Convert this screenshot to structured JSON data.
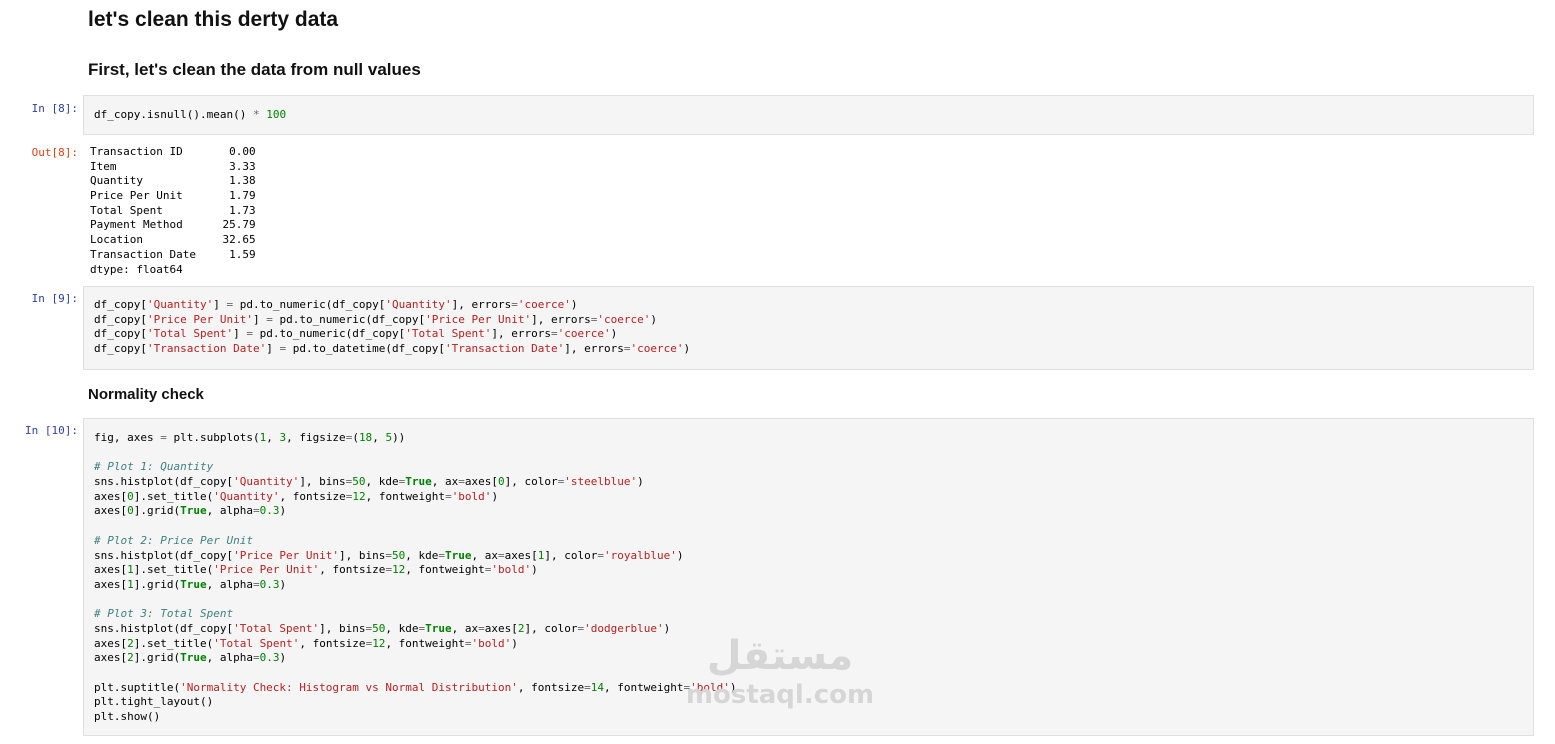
{
  "markdown": {
    "title": "let's clean this derty data",
    "subtitle_nulls": "First, let's clean the data from null values",
    "subtitle_normality": "Normality check"
  },
  "prompts": {
    "in8": "In [8]:",
    "out8": "Out[8]:",
    "in9": "In [9]:",
    "in10": "In [10]:"
  },
  "cells": {
    "in8": {
      "lines": [
        [
          {
            "t": "df_copy.isnull().mean() "
          },
          {
            "t": "*",
            "c": "o"
          },
          {
            "t": " "
          },
          {
            "t": "100",
            "c": "n"
          }
        ]
      ]
    },
    "in9": {
      "lines": [
        [
          {
            "t": "df_copy["
          },
          {
            "t": "'Quantity'",
            "c": "s"
          },
          {
            "t": "] "
          },
          {
            "t": "=",
            "c": "o"
          },
          {
            "t": " pd.to_numeric(df_copy["
          },
          {
            "t": "'Quantity'",
            "c": "s"
          },
          {
            "t": "], errors"
          },
          {
            "t": "=",
            "c": "o"
          },
          {
            "t": "'coerce'",
            "c": "s"
          },
          {
            "t": ")"
          }
        ],
        [
          {
            "t": "df_copy["
          },
          {
            "t": "'Price Per Unit'",
            "c": "s"
          },
          {
            "t": "] "
          },
          {
            "t": "=",
            "c": "o"
          },
          {
            "t": " pd.to_numeric(df_copy["
          },
          {
            "t": "'Price Per Unit'",
            "c": "s"
          },
          {
            "t": "], errors"
          },
          {
            "t": "=",
            "c": "o"
          },
          {
            "t": "'coerce'",
            "c": "s"
          },
          {
            "t": ")"
          }
        ],
        [
          {
            "t": "df_copy["
          },
          {
            "t": "'Total Spent'",
            "c": "s"
          },
          {
            "t": "] "
          },
          {
            "t": "=",
            "c": "o"
          },
          {
            "t": " pd.to_numeric(df_copy["
          },
          {
            "t": "'Total Spent'",
            "c": "s"
          },
          {
            "t": "], errors"
          },
          {
            "t": "=",
            "c": "o"
          },
          {
            "t": "'coerce'",
            "c": "s"
          },
          {
            "t": ")"
          }
        ],
        [
          {
            "t": "df_copy["
          },
          {
            "t": "'Transaction Date'",
            "c": "s"
          },
          {
            "t": "] "
          },
          {
            "t": "=",
            "c": "o"
          },
          {
            "t": " pd.to_datetime(df_copy["
          },
          {
            "t": "'Transaction Date'",
            "c": "s"
          },
          {
            "t": "], errors"
          },
          {
            "t": "=",
            "c": "o"
          },
          {
            "t": "'coerce'",
            "c": "s"
          },
          {
            "t": ")"
          }
        ]
      ]
    },
    "in10": {
      "lines": [
        [
          {
            "t": "fig, axes "
          },
          {
            "t": "=",
            "c": "o"
          },
          {
            "t": " plt.subplots("
          },
          {
            "t": "1",
            "c": "n"
          },
          {
            "t": ", "
          },
          {
            "t": "3",
            "c": "n"
          },
          {
            "t": ", figsize"
          },
          {
            "t": "=",
            "c": "o"
          },
          {
            "t": "("
          },
          {
            "t": "18",
            "c": "n"
          },
          {
            "t": ", "
          },
          {
            "t": "5",
            "c": "n"
          },
          {
            "t": "))"
          }
        ],
        [],
        [
          {
            "t": "# Plot 1: Quantity",
            "c": "c"
          }
        ],
        [
          {
            "t": "sns.histplot(df_copy["
          },
          {
            "t": "'Quantity'",
            "c": "s"
          },
          {
            "t": "], bins"
          },
          {
            "t": "=",
            "c": "o"
          },
          {
            "t": "50",
            "c": "n"
          },
          {
            "t": ", kde"
          },
          {
            "t": "=",
            "c": "o"
          },
          {
            "t": "True",
            "c": "k"
          },
          {
            "t": ", ax"
          },
          {
            "t": "=",
            "c": "o"
          },
          {
            "t": "axes["
          },
          {
            "t": "0",
            "c": "n"
          },
          {
            "t": "], color"
          },
          {
            "t": "=",
            "c": "o"
          },
          {
            "t": "'steelblue'",
            "c": "s"
          },
          {
            "t": ")"
          }
        ],
        [
          {
            "t": "axes["
          },
          {
            "t": "0",
            "c": "n"
          },
          {
            "t": "].set_title("
          },
          {
            "t": "'Quantity'",
            "c": "s"
          },
          {
            "t": ", fontsize"
          },
          {
            "t": "=",
            "c": "o"
          },
          {
            "t": "12",
            "c": "n"
          },
          {
            "t": ", fontweight"
          },
          {
            "t": "=",
            "c": "o"
          },
          {
            "t": "'bold'",
            "c": "s"
          },
          {
            "t": ")"
          }
        ],
        [
          {
            "t": "axes["
          },
          {
            "t": "0",
            "c": "n"
          },
          {
            "t": "].grid("
          },
          {
            "t": "True",
            "c": "k"
          },
          {
            "t": ", alpha"
          },
          {
            "t": "=",
            "c": "o"
          },
          {
            "t": "0.3",
            "c": "n"
          },
          {
            "t": ")"
          }
        ],
        [],
        [
          {
            "t": "# Plot 2: Price Per Unit",
            "c": "c"
          }
        ],
        [
          {
            "t": "sns.histplot(df_copy["
          },
          {
            "t": "'Price Per Unit'",
            "c": "s"
          },
          {
            "t": "], bins"
          },
          {
            "t": "=",
            "c": "o"
          },
          {
            "t": "50",
            "c": "n"
          },
          {
            "t": ", kde"
          },
          {
            "t": "=",
            "c": "o"
          },
          {
            "t": "True",
            "c": "k"
          },
          {
            "t": ", ax"
          },
          {
            "t": "=",
            "c": "o"
          },
          {
            "t": "axes["
          },
          {
            "t": "1",
            "c": "n"
          },
          {
            "t": "], color"
          },
          {
            "t": "=",
            "c": "o"
          },
          {
            "t": "'royalblue'",
            "c": "s"
          },
          {
            "t": ")"
          }
        ],
        [
          {
            "t": "axes["
          },
          {
            "t": "1",
            "c": "n"
          },
          {
            "t": "].set_title("
          },
          {
            "t": "'Price Per Unit'",
            "c": "s"
          },
          {
            "t": ", fontsize"
          },
          {
            "t": "=",
            "c": "o"
          },
          {
            "t": "12",
            "c": "n"
          },
          {
            "t": ", fontweight"
          },
          {
            "t": "=",
            "c": "o"
          },
          {
            "t": "'bold'",
            "c": "s"
          },
          {
            "t": ")"
          }
        ],
        [
          {
            "t": "axes["
          },
          {
            "t": "1",
            "c": "n"
          },
          {
            "t": "].grid("
          },
          {
            "t": "True",
            "c": "k"
          },
          {
            "t": ", alpha"
          },
          {
            "t": "=",
            "c": "o"
          },
          {
            "t": "0.3",
            "c": "n"
          },
          {
            "t": ")"
          }
        ],
        [],
        [
          {
            "t": "# Plot 3: Total Spent",
            "c": "c"
          }
        ],
        [
          {
            "t": "sns.histplot(df_copy["
          },
          {
            "t": "'Total Spent'",
            "c": "s"
          },
          {
            "t": "], bins"
          },
          {
            "t": "=",
            "c": "o"
          },
          {
            "t": "50",
            "c": "n"
          },
          {
            "t": ", kde"
          },
          {
            "t": "=",
            "c": "o"
          },
          {
            "t": "True",
            "c": "k"
          },
          {
            "t": ", ax"
          },
          {
            "t": "=",
            "c": "o"
          },
          {
            "t": "axes["
          },
          {
            "t": "2",
            "c": "n"
          },
          {
            "t": "], color"
          },
          {
            "t": "=",
            "c": "o"
          },
          {
            "t": "'dodgerblue'",
            "c": "s"
          },
          {
            "t": ")"
          }
        ],
        [
          {
            "t": "axes["
          },
          {
            "t": "2",
            "c": "n"
          },
          {
            "t": "].set_title("
          },
          {
            "t": "'Total Spent'",
            "c": "s"
          },
          {
            "t": ", fontsize"
          },
          {
            "t": "=",
            "c": "o"
          },
          {
            "t": "12",
            "c": "n"
          },
          {
            "t": ", fontweight"
          },
          {
            "t": "=",
            "c": "o"
          },
          {
            "t": "'bold'",
            "c": "s"
          },
          {
            "t": ")"
          }
        ],
        [
          {
            "t": "axes["
          },
          {
            "t": "2",
            "c": "n"
          },
          {
            "t": "].grid("
          },
          {
            "t": "True",
            "c": "k"
          },
          {
            "t": ", alpha"
          },
          {
            "t": "=",
            "c": "o"
          },
          {
            "t": "0.3",
            "c": "n"
          },
          {
            "t": ")"
          }
        ],
        [],
        [
          {
            "t": "plt.suptitle("
          },
          {
            "t": "'Normality Check: Histogram vs Normal Distribution'",
            "c": "s"
          },
          {
            "t": ", fontsize"
          },
          {
            "t": "=",
            "c": "o"
          },
          {
            "t": "14",
            "c": "n"
          },
          {
            "t": ", fontweight"
          },
          {
            "t": "=",
            "c": "o"
          },
          {
            "t": "'bold'",
            "c": "s"
          },
          {
            "t": ")"
          }
        ],
        [
          {
            "t": "plt.tight_layout()"
          }
        ],
        [
          {
            "t": "plt.show()"
          }
        ]
      ]
    }
  },
  "out8_lines": [
    "Transaction ID       0.00",
    "Item                 3.33",
    "Quantity             1.38",
    "Price Per Unit       1.79",
    "Total Spent          1.73",
    "Payment Method      25.79",
    "Location            32.65",
    "Transaction Date     1.59",
    "dtype: float64"
  ],
  "watermark": {
    "arabic": "مستقل",
    "latin": "mostaql.com"
  },
  "colors": {
    "string": "#ba2121",
    "number": "#008000",
    "keyword": "#008000",
    "comment": "#408080",
    "operator": "#666666",
    "in_prompt": "#303f9f",
    "out_prompt": "#d84315",
    "cell_bg": "#f5f5f5"
  }
}
